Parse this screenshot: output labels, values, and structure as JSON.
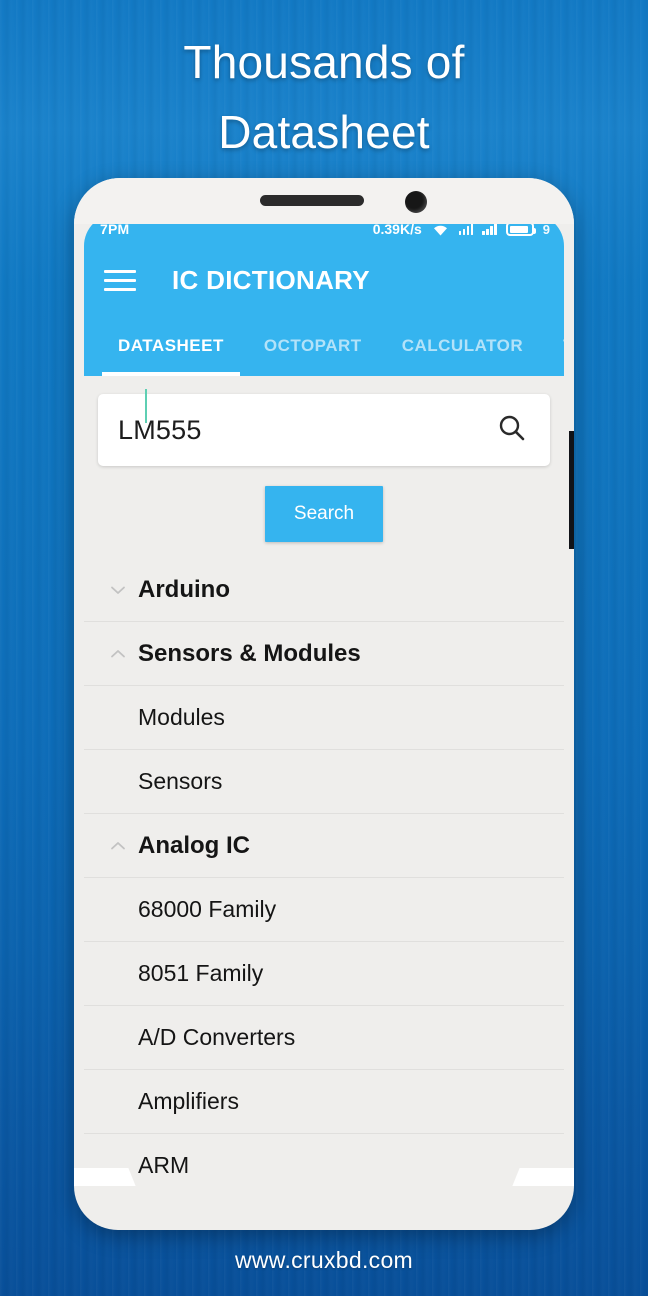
{
  "promo": {
    "headline_line1": "Thousands of",
    "headline_line2": "Datasheet",
    "footer_url": "www.cruxbd.com"
  },
  "statusbar": {
    "time": "7PM",
    "network_speed": "0.39K/s",
    "wifi_icon": "wifi-icon",
    "signal_icon_1": "signal-bars-icon",
    "signal_icon_2": "signal-bars-icon",
    "battery_icon": "battery-icon",
    "battery_percent": "9"
  },
  "appbar": {
    "menu_icon": "hamburger-menu-icon",
    "title": "IC DICTIONARY"
  },
  "tabs": [
    {
      "label": "DATASHEET",
      "active": true
    },
    {
      "label": "OCTOPART",
      "active": false
    },
    {
      "label": "CALCULATOR",
      "active": false
    },
    {
      "label": "TOOLS",
      "active": false
    }
  ],
  "search": {
    "value": "LM555",
    "icon": "search-magnifier-icon",
    "button_label": "Search"
  },
  "list": [
    {
      "label": "Arduino",
      "type": "group",
      "chevron": "chevron-down-icon"
    },
    {
      "label": "Sensors & Modules",
      "type": "group",
      "chevron": "chevron-up-icon"
    },
    {
      "label": "Modules",
      "type": "child"
    },
    {
      "label": "Sensors",
      "type": "child"
    },
    {
      "label": "Analog IC",
      "type": "group",
      "chevron": "chevron-up-icon"
    },
    {
      "label": "68000 Family",
      "type": "child"
    },
    {
      "label": "8051 Family",
      "type": "child"
    },
    {
      "label": "A/D Converters",
      "type": "child"
    },
    {
      "label": "Amplifiers",
      "type": "child"
    },
    {
      "label": "ARM",
      "type": "child"
    }
  ],
  "colors": {
    "accent": "#35b4ef",
    "background_blue": "#0d6cba",
    "screen_bg": "#efeeec",
    "caret": "#5ecfb3"
  }
}
